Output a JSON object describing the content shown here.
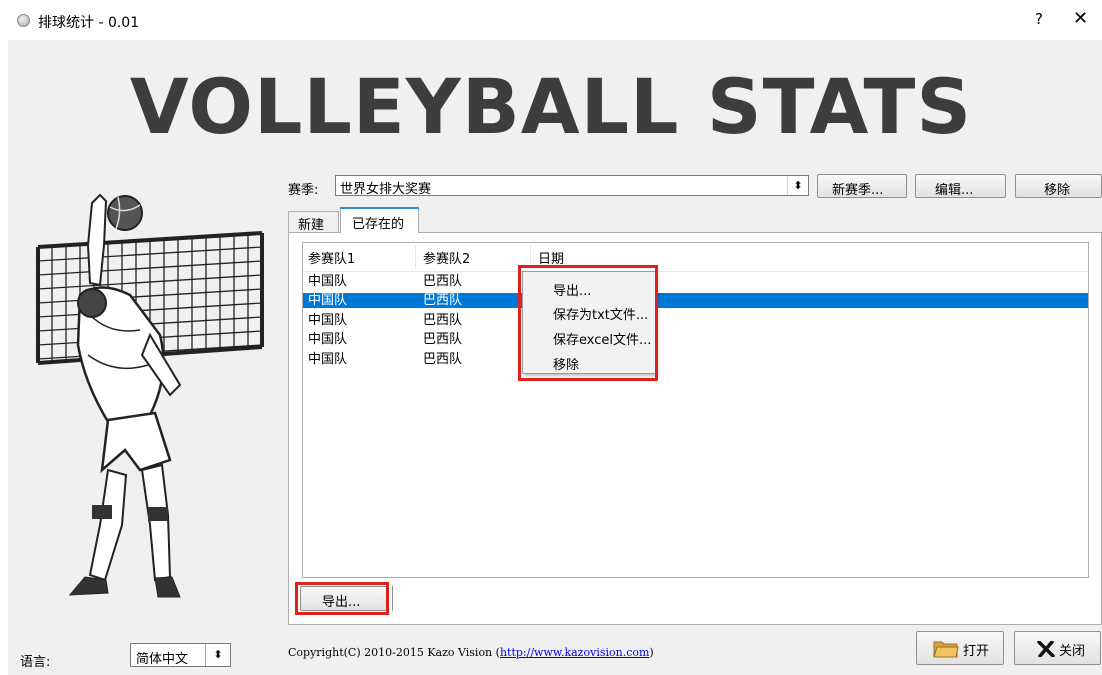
{
  "window": {
    "title": "排球统计 - 0.01",
    "help_label": "?",
    "close_label": "✕"
  },
  "banner": {
    "text": "VOLLEYBALL STATS"
  },
  "season": {
    "label": "赛季:",
    "selected": "世界女排大奖赛",
    "new_label": "新赛季...",
    "edit_label": "编辑...",
    "remove_label": "移除"
  },
  "tabs": [
    {
      "label": "新建",
      "active": false
    },
    {
      "label": "已存在的",
      "active": true
    }
  ],
  "table": {
    "columns": [
      "参赛队1",
      "参赛队2",
      "日期"
    ],
    "rows": [
      {
        "team1": "中国队",
        "team2": "巴西队",
        "date": "",
        "selected": false
      },
      {
        "team1": "中国队",
        "team2": "巴西队",
        "date": "",
        "selected": true
      },
      {
        "team1": "中国队",
        "team2": "巴西队",
        "date": "",
        "selected": false
      },
      {
        "team1": "中国队",
        "team2": "巴西队",
        "date": "",
        "selected": false
      },
      {
        "team1": "中国队",
        "team2": "巴西队",
        "date": "",
        "selected": false
      }
    ]
  },
  "context_menu": {
    "items": [
      "导出...",
      "保存为txt文件...",
      "保存excel文件...",
      "移除"
    ]
  },
  "export_button": {
    "label": "导出..."
  },
  "language": {
    "label": "语言:",
    "selected": "简体中文"
  },
  "footer": {
    "copyright_prefix": "Copyright(C) 2010-2015 Kazo Vision (",
    "link": "http://www.kazovision.com",
    "copyright_suffix": ")",
    "open_label": "打开",
    "close_label": "关闭"
  },
  "icons": {
    "app": "volleyball-icon",
    "open": "folder-icon",
    "close": "x-mark-icon",
    "dropdown": "updown-arrows-icon"
  },
  "colors": {
    "selection": "#0078d7",
    "highlight_box": "#e0201c",
    "banner_text": "#3d3d3d",
    "link": "#0000ee"
  }
}
